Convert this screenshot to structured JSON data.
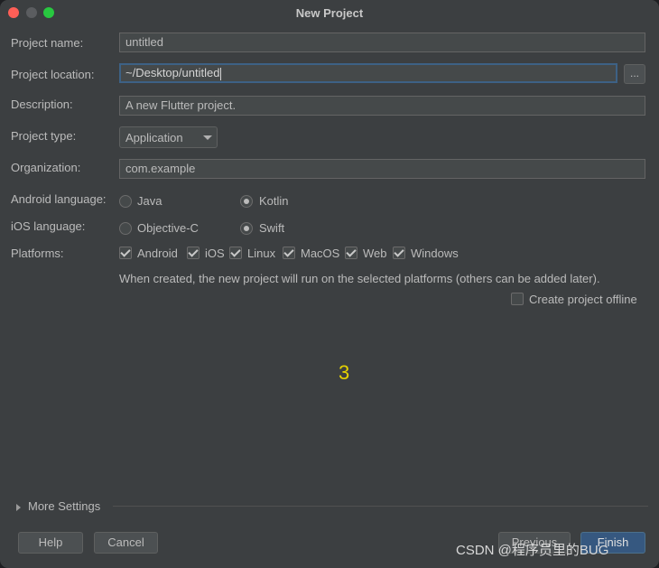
{
  "window": {
    "title": "New Project"
  },
  "form": {
    "project_name": {
      "label": "Project name:",
      "value": "untitled"
    },
    "project_location": {
      "label": "Project location:",
      "value": "~/Desktop/untitled",
      "browse_label": "..."
    },
    "description": {
      "label": "Description:",
      "value": "A new Flutter project."
    },
    "project_type": {
      "label": "Project type:",
      "selected": "Application"
    },
    "organization": {
      "label": "Organization:",
      "value": "com.example"
    },
    "android_language": {
      "label": "Android language:",
      "options": [
        "Java",
        "Kotlin"
      ],
      "selected": "Kotlin"
    },
    "ios_language": {
      "label": "iOS language:",
      "options": [
        "Objective-C",
        "Swift"
      ],
      "selected": "Swift"
    },
    "platforms": {
      "label": "Platforms:",
      "items": [
        {
          "label": "Android",
          "checked": true
        },
        {
          "label": "iOS",
          "checked": true
        },
        {
          "label": "Linux",
          "checked": true
        },
        {
          "label": "MacOS",
          "checked": true
        },
        {
          "label": "Web",
          "checked": true
        },
        {
          "label": "Windows",
          "checked": true
        }
      ],
      "note": "When created, the new project will run on the selected platforms (others can be added later)."
    },
    "offline": {
      "label": "Create project offline",
      "checked": false
    }
  },
  "annotation": "3",
  "more_settings": {
    "label": "More Settings"
  },
  "buttons": {
    "help": "Help",
    "cancel": "Cancel",
    "previous": "Previous",
    "finish": "Finish"
  },
  "watermark": "CSDN @程序员里的BUG"
}
